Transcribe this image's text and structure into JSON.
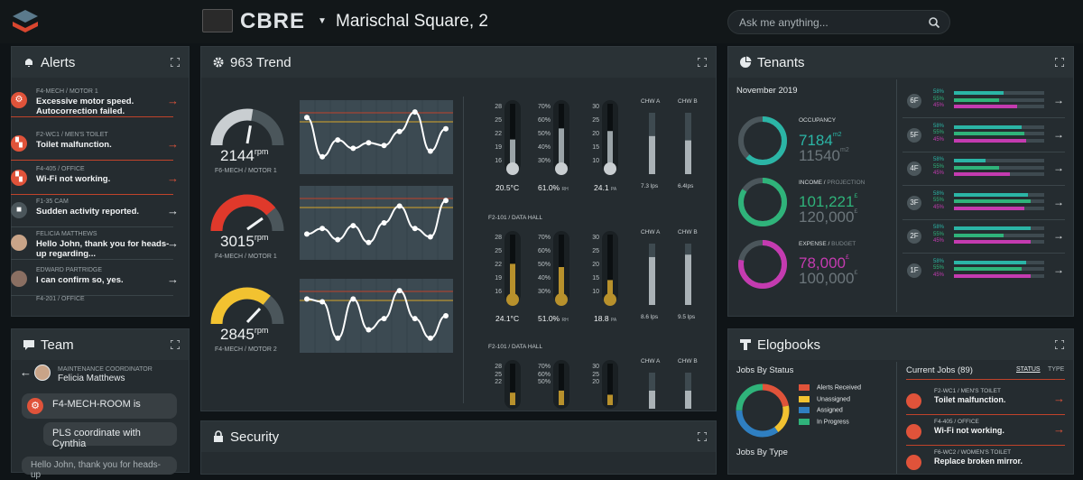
{
  "header": {
    "brand": "CBRE",
    "location": "Marischal Square, 2",
    "search_placeholder": "Ask me anything..."
  },
  "alerts": {
    "title": "Alerts",
    "items": [
      {
        "tag": "F4-MECH / MOTOR 1",
        "msg": "Excessive motor speed. Autocorrection failed.",
        "icon": "gear-icon",
        "color": "#e0533a"
      },
      {
        "tag": "F2-WC1 / MEN'S TOILET",
        "msg": "Toilet malfunction.",
        "icon": "wrench-icon",
        "color": "#e0533a"
      },
      {
        "tag": "F4-405 / OFFICE",
        "msg": "Wi-Fi not working.",
        "icon": "wrench-icon",
        "color": "#e0533a"
      },
      {
        "tag": "F1-35 CAM",
        "msg": "Sudden activity reported.",
        "icon": "lock-icon",
        "color": "#4b565b"
      },
      {
        "tag": "FELICIA MATTHEWS",
        "msg": "Hello John, thank you for heads-up regarding...",
        "icon": "avatar",
        "color": "#c9a488"
      },
      {
        "tag": "EDWARD PARTRIDGE",
        "msg": "I can confirm so, yes.",
        "icon": "avatar",
        "color": "#8a6f62"
      },
      {
        "tag": "F4-201 / OFFICE",
        "msg": "",
        "icon": "",
        "color": ""
      }
    ]
  },
  "team": {
    "title": "Team",
    "role": "MAINTENANCE COORDINATOR",
    "name": "Felicia Matthews",
    "msg1": "F4-MECH-ROOM is",
    "msg2": "PLS coordinate with Cynthia",
    "msg3": "Hello John, thank you for heads-up"
  },
  "trend": {
    "title": "963 Trend",
    "gauges": [
      {
        "value": "2144",
        "unit": "rpm",
        "label": "F6-MECH / MOTOR 1",
        "color": "#c9ced1",
        "level": 0.55
      },
      {
        "value": "3015",
        "unit": "rpm",
        "label": "F4-MECH / MOTOR 1",
        "color": "#e0392b",
        "level": 0.78
      },
      {
        "value": "2845",
        "unit": "rpm",
        "label": "F4-MECH / MOTOR 2",
        "color": "#f2c230",
        "level": 0.72
      }
    ],
    "sections": [
      {
        "label": "",
        "t1": "20.5°C",
        "t2": "61.0%",
        "t2u": "RH",
        "t3": "24.1",
        "t3u": "PA",
        "chwa": "7.3 lps",
        "chwb": "6.4lps",
        "fill1": 0.45,
        "fill2": 0.62,
        "fill3": 0.58,
        "color": "#9aa3a7",
        "ha": 0.62,
        "hb": 0.55
      },
      {
        "label": "F2-101 / DATA HALL",
        "t1": "24.1°C",
        "t2": "51.0%",
        "t2u": "RH",
        "t3": "18.8",
        "t3u": "PA",
        "chwa": "8.6 lps",
        "chwb": "9.5 lps",
        "fill1": 0.55,
        "fill2": 0.5,
        "fill3": 0.3,
        "color": "#b8912c",
        "ha": 0.78,
        "hb": 0.82
      },
      {
        "label": "F2-101 / DATA HALL",
        "t1": "",
        "t2": "",
        "t2u": "",
        "t3": "",
        "t3u": "",
        "chwa": "",
        "chwb": "",
        "fill1": 0.3,
        "fill2": 0.35,
        "fill3": 0.25,
        "color": "#b8912c",
        "ha": 0.5,
        "hb": 0.5
      }
    ],
    "scale1": [
      "28",
      "25",
      "22",
      "19",
      "16"
    ],
    "scale2": [
      "70%",
      "60%",
      "50%",
      "40%",
      "30%"
    ],
    "scale3": [
      "30",
      "25",
      "20",
      "15",
      "10"
    ],
    "chw_a": "CHW A",
    "chw_b": "CHW B"
  },
  "security": {
    "title": "Security"
  },
  "tenants": {
    "title": "Tenants",
    "month": "November 2019",
    "occupancy": {
      "label": "OCCUPANCY",
      "value": "7184",
      "unit": "m2",
      "total": "11540",
      "color": "#2bb5a6",
      "ratio": 0.62
    },
    "income": {
      "label": "INCOME",
      "label2": "PROJECTION",
      "value": "101,221",
      "unit": "£",
      "total": "120,000",
      "color": "#2fb37a",
      "ratio": 0.84
    },
    "expense": {
      "label": "EXPENSE",
      "label2": "BUDGET",
      "value": "78,000",
      "unit": "£",
      "total": "100,000",
      "color": "#c43bb0",
      "ratio": 0.78
    },
    "floors": [
      {
        "name": "6F",
        "p1": "58%",
        "p2": "55%",
        "p3": "45%",
        "v1": 0.55,
        "v2": 0.5,
        "v3": 0.7
      },
      {
        "name": "5F",
        "p1": "58%",
        "p2": "55%",
        "p3": "45%",
        "v1": 0.75,
        "v2": 0.78,
        "v3": 0.8
      },
      {
        "name": "4F",
        "p1": "58%",
        "p2": "55%",
        "p3": "45%",
        "v1": 0.35,
        "v2": 0.5,
        "v3": 0.62
      },
      {
        "name": "3F",
        "p1": "58%",
        "p2": "55%",
        "p3": "45%",
        "v1": 0.82,
        "v2": 0.85,
        "v3": 0.78
      },
      {
        "name": "2F",
        "p1": "58%",
        "p2": "55%",
        "p3": "45%",
        "v1": 0.85,
        "v2": 0.55,
        "v3": 0.85
      },
      {
        "name": "1F",
        "p1": "58%",
        "p2": "55%",
        "p3": "45%",
        "v1": 0.8,
        "v2": 0.75,
        "v3": 0.85
      }
    ]
  },
  "elogbooks": {
    "title": "Elogbooks",
    "jobs_by_status": "Jobs By Status",
    "jobs_by_type": "Jobs By Type",
    "legend": [
      {
        "label": "Alerts Received",
        "color": "#e0533a"
      },
      {
        "label": "Unassigned",
        "color": "#f2c230"
      },
      {
        "label": "Assigned",
        "color": "#2f7fc1"
      },
      {
        "label": "In Progress",
        "color": "#2fb37a"
      }
    ],
    "current_jobs": "Current Jobs (89)",
    "sort_status": "STATUS",
    "sort_type": "TYPE",
    "jobs": [
      {
        "tag": "F2-WC1 / MEN'S TOILET",
        "msg": "Toilet malfunction."
      },
      {
        "tag": "F4-405 / OFFICE",
        "msg": "Wi-Fi not working."
      },
      {
        "tag": "F6-WC2 / WOMEN'S TOILET",
        "msg": "Replace broken mirror."
      }
    ]
  },
  "colors": {
    "accent_red": "#e0533a",
    "teal": "#2bb5a6",
    "green": "#2fb37a",
    "magenta": "#c43bb0"
  }
}
